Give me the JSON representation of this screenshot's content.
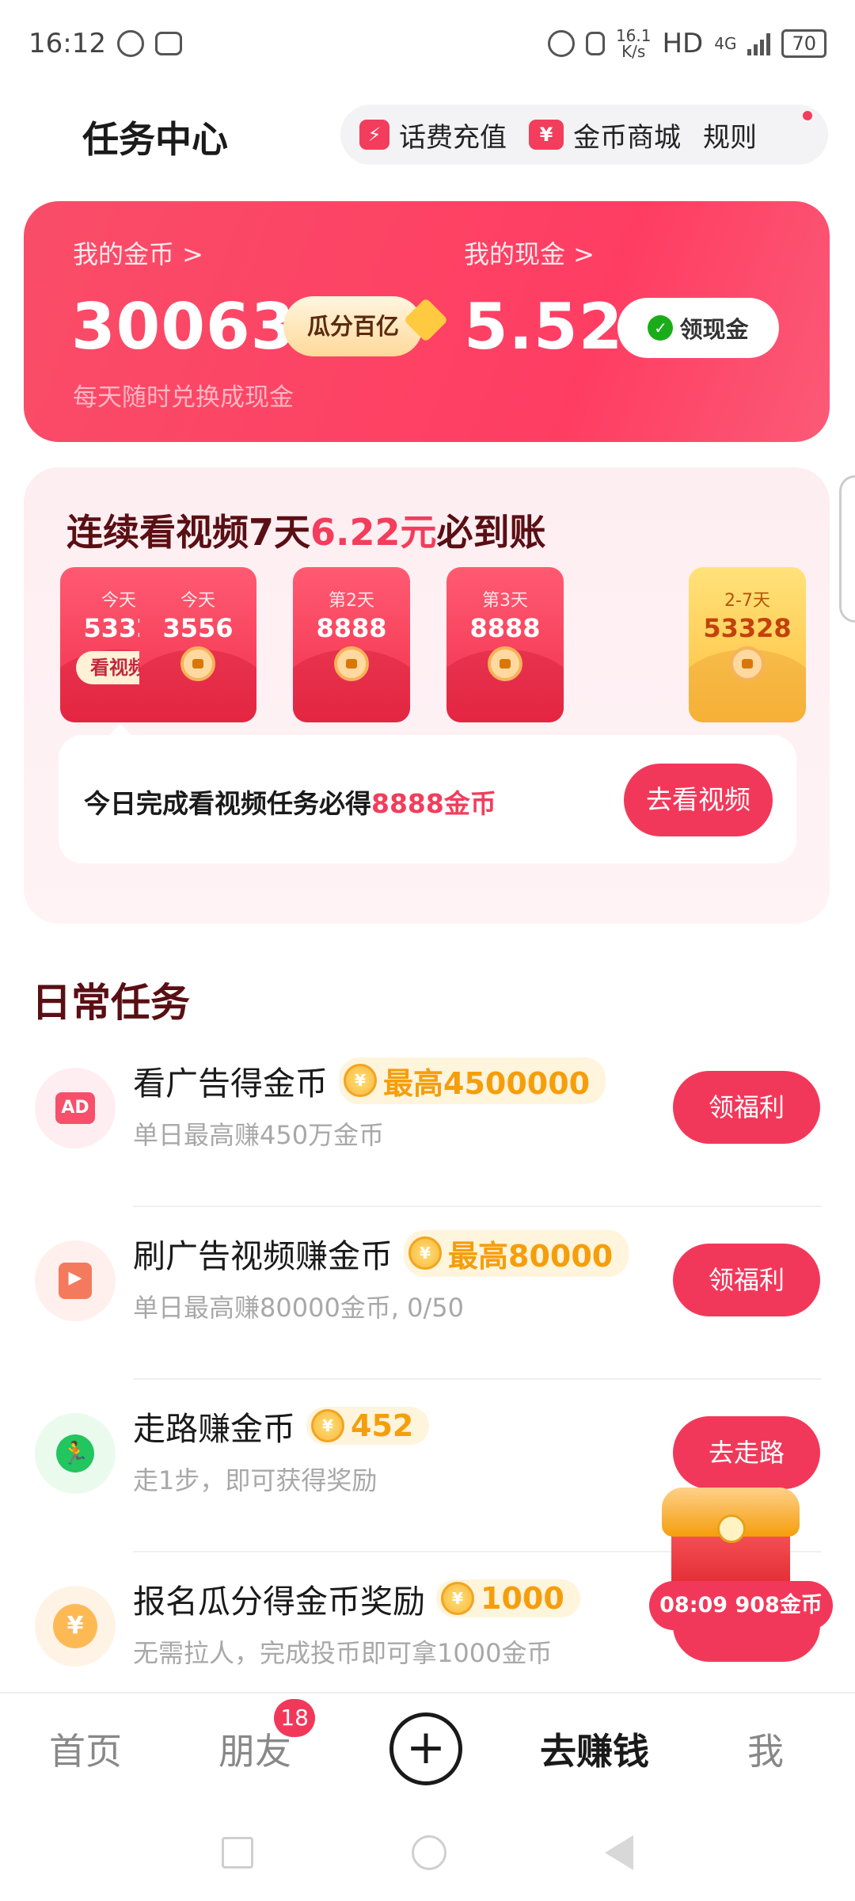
{
  "status_bar": {
    "time": "16:12",
    "net_speed": "16.1",
    "net_unit": "K/s",
    "hd": "HD",
    "network": "4G",
    "battery": "70"
  },
  "header": {
    "title": "任务中心",
    "recharge_label": "话费充值",
    "mall_label": "金币商城",
    "rules_label": "规则",
    "recharge_icon": "lightning-icon",
    "mall_icon": "yuan-ticket-icon",
    "mall_icon_glyph": "¥"
  },
  "coins": {
    "my_coins_label": "我的金币 >",
    "coins_value": "30063",
    "split_label": "瓜分百亿",
    "my_cash_label": "我的现金 >",
    "cash_value": "5.52",
    "claim_cash_label": "领现金",
    "subtitle": "每天随时兑换成现金"
  },
  "streak": {
    "title_prefix": "连续看视频7天",
    "title_highlight": "6.22元",
    "title_suffix": "必到账",
    "envelopes": [
      {
        "day": "今天",
        "amount": "5332",
        "action": "看视频"
      },
      {
        "day": "今天",
        "amount": "3556"
      },
      {
        "day": "第2天",
        "amount": "8888"
      },
      {
        "day": "第3天",
        "amount": "8888"
      },
      {
        "day": "2-7天",
        "amount": "53328"
      }
    ],
    "task_prefix": "今日完成看视频任务必得",
    "task_highlight": "8888金币",
    "watch_button": "去看视频"
  },
  "daily": {
    "title": "日常任务",
    "tasks": [
      {
        "name": "看广告得金币",
        "reward": "最高4500000",
        "desc": "单日最高赚450万金币",
        "button": "领福利",
        "icon": "ad-icon",
        "icon_text": "AD"
      },
      {
        "name": "刷广告视频赚金币",
        "reward": "最高80000",
        "desc": "单日最高赚80000金币, 0/50",
        "button": "领福利",
        "icon": "video-icon"
      },
      {
        "name": "走路赚金币",
        "reward": "452",
        "desc": "走1步，即可获得奖励",
        "button": "去走路",
        "icon": "running-man-icon"
      },
      {
        "name": "报名瓜分得金币奖励",
        "reward": "1000",
        "desc": "无需拉人，完成投币即可拿1000金币",
        "button": "",
        "icon": "yuan-coin-icon",
        "icon_text": "¥"
      }
    ]
  },
  "floating": {
    "timer_text": "08:09 908金币"
  },
  "nav": {
    "home": "首页",
    "friends": "朋友",
    "friends_badge": "18",
    "earn": "去赚钱",
    "me": "我"
  },
  "colors": {
    "accent": "#f2385a",
    "gold": "#f59e0b",
    "dark_title": "#5a0f14"
  }
}
